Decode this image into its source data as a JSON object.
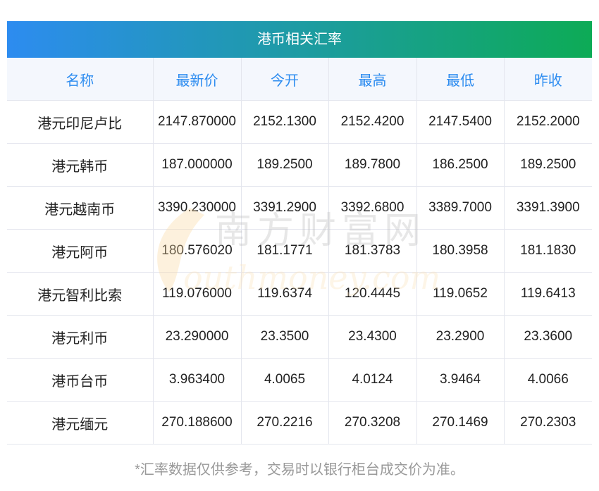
{
  "title": "港币相关汇率",
  "columns": [
    "名称",
    "最新价",
    "今开",
    "最高",
    "最低",
    "昨收"
  ],
  "rows": [
    [
      "港元印尼卢比",
      "2147.870000",
      "2152.1300",
      "2152.4200",
      "2147.5400",
      "2152.2000"
    ],
    [
      "港元韩币",
      "187.000000",
      "189.2500",
      "189.7800",
      "186.2500",
      "189.2500"
    ],
    [
      "港元越南币",
      "3390.230000",
      "3391.2900",
      "3392.6800",
      "3389.7000",
      "3391.3900"
    ],
    [
      "港元阿币",
      "180.576020",
      "181.1771",
      "181.3783",
      "180.3958",
      "181.1830"
    ],
    [
      "港元智利比索",
      "119.076000",
      "119.6374",
      "120.4445",
      "119.0652",
      "119.6413"
    ],
    [
      "港元利币",
      "23.290000",
      "23.3500",
      "23.4300",
      "23.2900",
      "23.3600"
    ],
    [
      "港币台币",
      "3.963400",
      "4.0065",
      "4.0124",
      "3.9464",
      "4.0066"
    ],
    [
      "港元缅元",
      "270.188600",
      "270.2216",
      "270.3208",
      "270.1469",
      "270.2303"
    ]
  ],
  "watermark": {
    "cn": "南方财富网",
    "en": "southmoney.com"
  },
  "footnote": "*汇率数据仅供参考，交易时以银行柜台成交价为准。",
  "colors": {
    "gradient_start": "#2d8cf0",
    "gradient_end": "#0dab56",
    "header_text": "#2d8cf0"
  }
}
